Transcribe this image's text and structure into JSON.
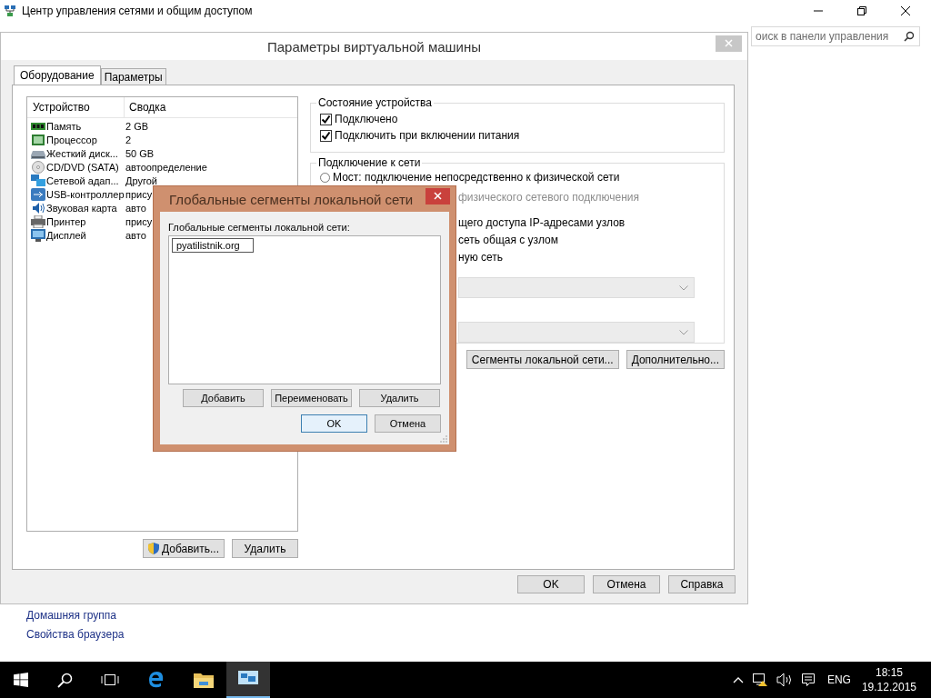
{
  "background_window": {
    "title": "Центр управления сетями и общим доступом",
    "search": {
      "placeholder": "оиск в панели управления"
    },
    "links": [
      "Домашняя группа",
      "Свойства браузера"
    ]
  },
  "dialog": {
    "title": "Параметры виртуальной машины",
    "tabs": [
      {
        "label": "Оборудование",
        "selected": true
      },
      {
        "label": "Параметры",
        "selected": false
      }
    ],
    "devices": {
      "columns": [
        "Устройство",
        "Сводка"
      ],
      "rows": [
        {
          "kind": "memory",
          "name": "Память",
          "summary": "2 GB"
        },
        {
          "kind": "cpu",
          "name": "Процессор",
          "summary": "2"
        },
        {
          "kind": "disk",
          "name": "Жесткий диск...",
          "summary": "50 GB"
        },
        {
          "kind": "cdrom",
          "name": "CD/DVD (SATA)",
          "summary": "автоопределение"
        },
        {
          "kind": "network",
          "name": "Сетевой адап...",
          "summary": "Другой"
        },
        {
          "kind": "usb",
          "name": "USB-контроллер",
          "summary": "прису"
        },
        {
          "kind": "sound",
          "name": "Звуковая карта",
          "summary": "авто"
        },
        {
          "kind": "printer",
          "name": "Принтер",
          "summary": "прису"
        },
        {
          "kind": "display",
          "name": "Дисплей",
          "summary": "авто"
        }
      ]
    },
    "device_buttons": [
      {
        "label": "Добавить...",
        "elevated": true
      },
      {
        "label": "Удалить",
        "elevated": false
      }
    ],
    "device_state": {
      "title": "Состояние устройства",
      "options": [
        {
          "label": "Подключено",
          "checked": true
        },
        {
          "label": "Подключить при включении питания",
          "checked": true
        }
      ]
    },
    "network": {
      "title": "Подключение к сети",
      "bridge": {
        "label": "Мост: подключение непосредственно к физической сети",
        "selected": false
      },
      "partial_lines": [
        {
          "text": "физического сетевого подключения",
          "disabled": true
        },
        {
          "text": "щего доступа IP-адресами узлов",
          "disabled": false
        },
        {
          "text": "сеть общая с узлом",
          "disabled": false
        },
        {
          "text": "ную сеть",
          "disabled": false
        }
      ],
      "dropdowns": [
        {
          "disabled": true
        },
        {
          "disabled": true
        }
      ],
      "buttons": [
        "Сегменты локальной сети...",
        "Дополнительно..."
      ]
    },
    "buttons": [
      "OK",
      "Отмена",
      "Справка"
    ]
  },
  "modal": {
    "title": "Глобальные сегменты локальной сети",
    "list_label": "Глобальные сегменты локальной сети:",
    "segments": [
      {
        "name": "pyatilistnik.org",
        "selected": true
      }
    ],
    "actions": [
      "Добавить",
      "Переименовать",
      "Удалить"
    ],
    "buttons": [
      {
        "label": "OK",
        "default": true
      },
      {
        "label": "Отмена",
        "default": false
      }
    ]
  },
  "taskbar": {
    "language": "ENG",
    "time": "18:15",
    "date": "19.12.2015"
  }
}
